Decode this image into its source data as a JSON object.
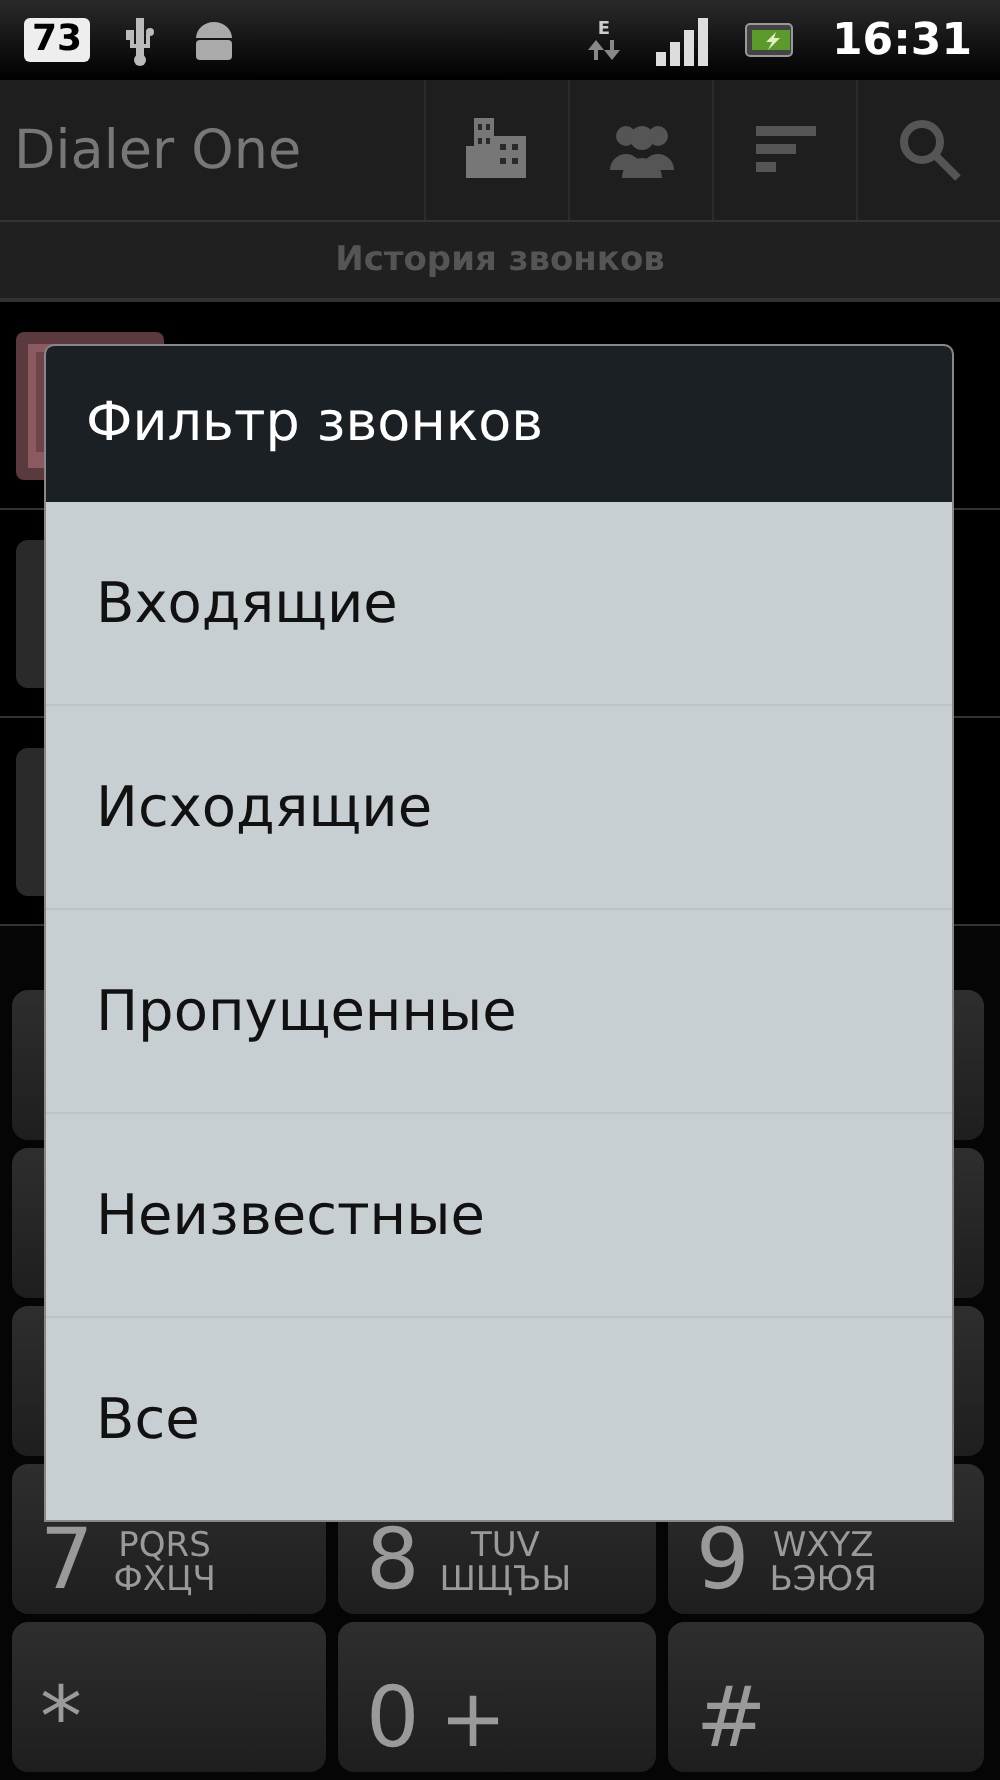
{
  "status_bar": {
    "notification_count": "73",
    "network_type": "E",
    "time": "16:31"
  },
  "app_bar": {
    "title": "Dialer One"
  },
  "section_header": "История звонков",
  "dialog": {
    "title": "Фильтр звонков",
    "options": [
      "Входящие",
      "Исходящие",
      "Пропущенные",
      "Неизвестные",
      "Все"
    ]
  },
  "keypad": {
    "keys": [
      {
        "digit": "7",
        "letters": "PQRS",
        "letters_local": "ФХЦЧ"
      },
      {
        "digit": "8",
        "letters": "TUV",
        "letters_local": "ШЩЪЫ"
      },
      {
        "digit": "9",
        "letters": "WXYZ",
        "letters_local": "ЬЭЮЯ"
      },
      {
        "digit": "*"
      },
      {
        "digit": "0",
        "letters": "+"
      },
      {
        "digit": "#"
      }
    ]
  }
}
